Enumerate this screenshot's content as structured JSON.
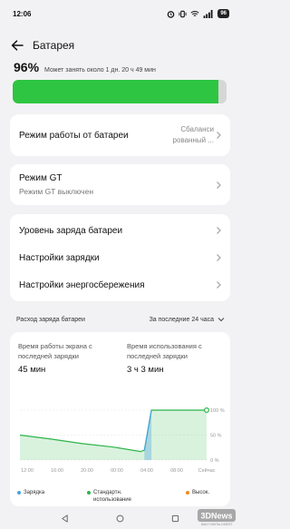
{
  "status_bar": {
    "time": "12:06",
    "battery_badge": "96",
    "icons": [
      "alarm-icon",
      "vibrate-icon",
      "wifi-icon",
      "signal-icon",
      "battery-icon"
    ]
  },
  "header": {
    "title": "Батарея",
    "back_icon": "arrow-left-icon"
  },
  "battery": {
    "percent": "96%",
    "remaining_note": "Может занять около 1 дн. 20 ч 49 мин",
    "level": 0.96,
    "fill_color": "#2ec542"
  },
  "mode_card": {
    "label": "Режим работы от батареи",
    "value": "Сбаланси рованный ..."
  },
  "gt_card": {
    "label": "Режим GT",
    "sub": "Режим GT выключен"
  },
  "settings_card": {
    "items": [
      {
        "label": "Уровень заряда батареи"
      },
      {
        "label": "Настройки зарядки"
      },
      {
        "label": "Настройки энергосбережения"
      }
    ]
  },
  "usage": {
    "title": "Расход заряда батареи",
    "period": "За последние 24 часа",
    "screen_time_label": "Время работы экрана с последней зарядки",
    "screen_time_value": "45 мин",
    "use_time_label": "Время использования с последней зарядки",
    "use_time_value": "3 ч 3 мин"
  },
  "chart_data": {
    "type": "line",
    "x": [
      "12:00",
      "16:00",
      "20:00",
      "00:00",
      "04:00",
      "08:00",
      "Сейчас"
    ],
    "y_ticks": [
      "100 %",
      "50 %",
      "0 %"
    ],
    "ylim": [
      0,
      100
    ],
    "series": [
      {
        "name": "Зарядка",
        "color": "#4aa3e0",
        "points": [
          [
            16.0,
            20
          ],
          [
            16.9,
            100
          ]
        ]
      },
      {
        "name": "Стандартн. использование",
        "color": "#2db54a",
        "points": [
          [
            0,
            50
          ],
          [
            4,
            42
          ],
          [
            8,
            33
          ],
          [
            12,
            26
          ],
          [
            15.5,
            17
          ],
          [
            16.0,
            20
          ],
          [
            16.9,
            100
          ],
          [
            24,
            100
          ]
        ]
      },
      {
        "name": "Высок.",
        "color": "#f08a24",
        "points": []
      }
    ],
    "legend": [
      "Зарядка",
      "Стандартн. использование",
      "Высок."
    ]
  },
  "nav": {
    "icons": [
      "back-triangle-icon",
      "home-circle-icon",
      "recents-square-icon"
    ]
  },
  "watermark": {
    "text": "3DNews",
    "sub": "DAILY DIGITAL DIGEST"
  }
}
